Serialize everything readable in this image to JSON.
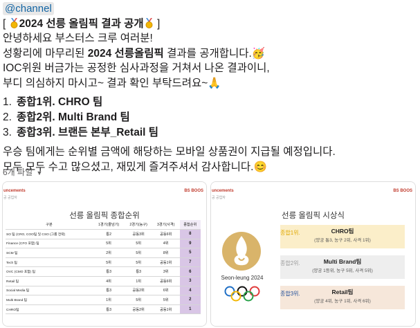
{
  "message": {
    "mention": "@channel",
    "title_bracket_open": "[",
    "title_text": "2024 선릉 올림픽 결과 공개",
    "title_bracket_close": "]",
    "lines": [
      "안녕하세요 부스터스 크루 여러분!",
      "IOC위원 버금가는 공정한 심사과정을 거쳐서 나온 결과이니,",
      "부디 의심하지 마시고~ 결과 확인 부탁드려요~"
    ],
    "line2_pre": "성황리에 마무리된 ",
    "line2_bold": "2024 선릉올림픽",
    "line2_post": " 결과를 공개합니다.",
    "party_emoji": "🥳",
    "pray_emoji": "🙏",
    "smile_emoji": "😊",
    "ranking": [
      {
        "num": "1.",
        "label": "종합1위. CHRO 팀"
      },
      {
        "num": "2.",
        "label": "종합2위. Multi Brand 팀"
      },
      {
        "num": "3.",
        "label": "종합3위. 브랜든 본부_Retail 팀"
      }
    ],
    "closing": [
      "우승 팀에게는 순위별 금액에 해당하는 모바일 상품권이 지급될 예정입니다.",
      "모두 모두 수고 많으셨고, 재밌게 즐겨주셔서 감사합니다."
    ]
  },
  "files": {
    "label": "6개 파일",
    "caret": "▼"
  },
  "file1": {
    "header_left": "uncements",
    "header_left2": "공 공업자",
    "header_right": "BS BOOS",
    "title": "선릉 올림픽 종합순위",
    "columns": [
      "구분",
      "1경기(줄넘기)",
      "2경기(농구)",
      "3경기(사격)",
      "종합순위"
    ],
    "rows": [
      [
        "SO 팀 (CRO, COO팀 및 CSO (그룹 전략)",
        "통2",
        "공동3위",
        "공동6위",
        "8"
      ],
      [
        "Finance (CFO 포함) 팀",
        "5위",
        "5위",
        "4위",
        "9"
      ],
      [
        "SCM 팀",
        "2위",
        "5위",
        "8위",
        "5"
      ],
      [
        "Tech 팀",
        "5위",
        "5위",
        "공동1위",
        "7"
      ],
      [
        "OVC (CMO 포함) 팀",
        "통3",
        "통3",
        "3위",
        "6"
      ],
      [
        "Retail 팀",
        "4위",
        "1위",
        "공동6위",
        "3"
      ],
      [
        "Social Media 팀",
        "통3",
        "공동2위",
        "6위",
        "4"
      ],
      [
        "Multi Brand 팀",
        "1위",
        "5위",
        "5위",
        "2"
      ],
      [
        "CHRO팀",
        "통3",
        "공동2위",
        "공동1위",
        "1"
      ]
    ]
  },
  "file2": {
    "header_left": "uncements",
    "header_left2": "공 공업자",
    "header_right": "BS BOOS",
    "title": "선릉 올림픽 시상식",
    "logo_text": "Seon-leung 2024",
    "awards": [
      {
        "place": "종합1위.",
        "team": "CHRO팀",
        "prize": "(양궁 통3, 농구 2위, 사격 1위)"
      },
      {
        "place": "종합2위.",
        "team": "Multi Brand팀",
        "prize": "(양궁 1등위, 농구 5위, 사격 5위)"
      },
      {
        "place": "종합3위.",
        "team": "Retail팀",
        "prize": "(양궁 4위, 농구 1위, 사격 6위)"
      }
    ]
  },
  "colors": {
    "mention_text": "#1264a3",
    "gold": "#e0a800",
    "final_rank_bg": "#d9c6e6",
    "sheet_accent": "#c0392b"
  }
}
